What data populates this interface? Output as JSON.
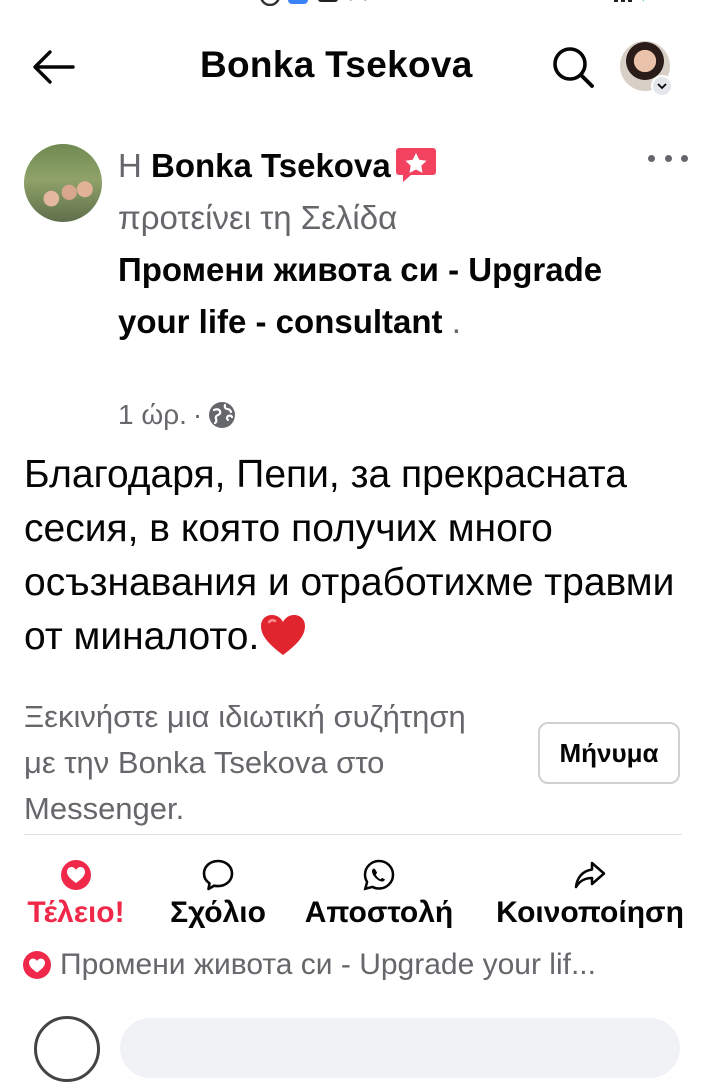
{
  "header": {
    "title": "Bonka Tsekova",
    "back_icon": "arrow-left-icon",
    "search_icon": "search-icon"
  },
  "post": {
    "article": "Η",
    "author": "Bonka Tsekova",
    "verb": "προτείνει τη Σελίδα",
    "page_name": "Промени живота си - Upgrade your life - consultant",
    "trailing_dot": ".",
    "timestamp": "1 ώρ.",
    "separator": "·",
    "privacy_icon": "globe-icon",
    "body": "Благодаря, Пепи, за прекрасната сесия, в която получих много осъзнавания и отработихме травми от миналото.",
    "body_emoji": "red-heart-icon"
  },
  "messenger": {
    "prompt": "Ξεκινήστε μια ιδιωτική συζήτηση με την Bonka Tsekova στο Messenger.",
    "button_label": "Μήνυμα"
  },
  "actions": [
    {
      "label": "Τέλειο!",
      "icon": "love-reaction-icon",
      "active": true,
      "color": "#f02849"
    },
    {
      "label": "Σχόλιο",
      "icon": "comment-icon"
    },
    {
      "label": "Αποστολή",
      "icon": "whatsapp-icon"
    },
    {
      "label": "Κοινοποίηση",
      "icon": "share-icon"
    }
  ],
  "reaction_summary": {
    "icon": "love-reaction-icon",
    "text": "Промени живота си - Upgrade your lif..."
  },
  "colors": {
    "secondary_text": "#65676b",
    "love": "#f02849",
    "divider": "#dddfe2"
  }
}
